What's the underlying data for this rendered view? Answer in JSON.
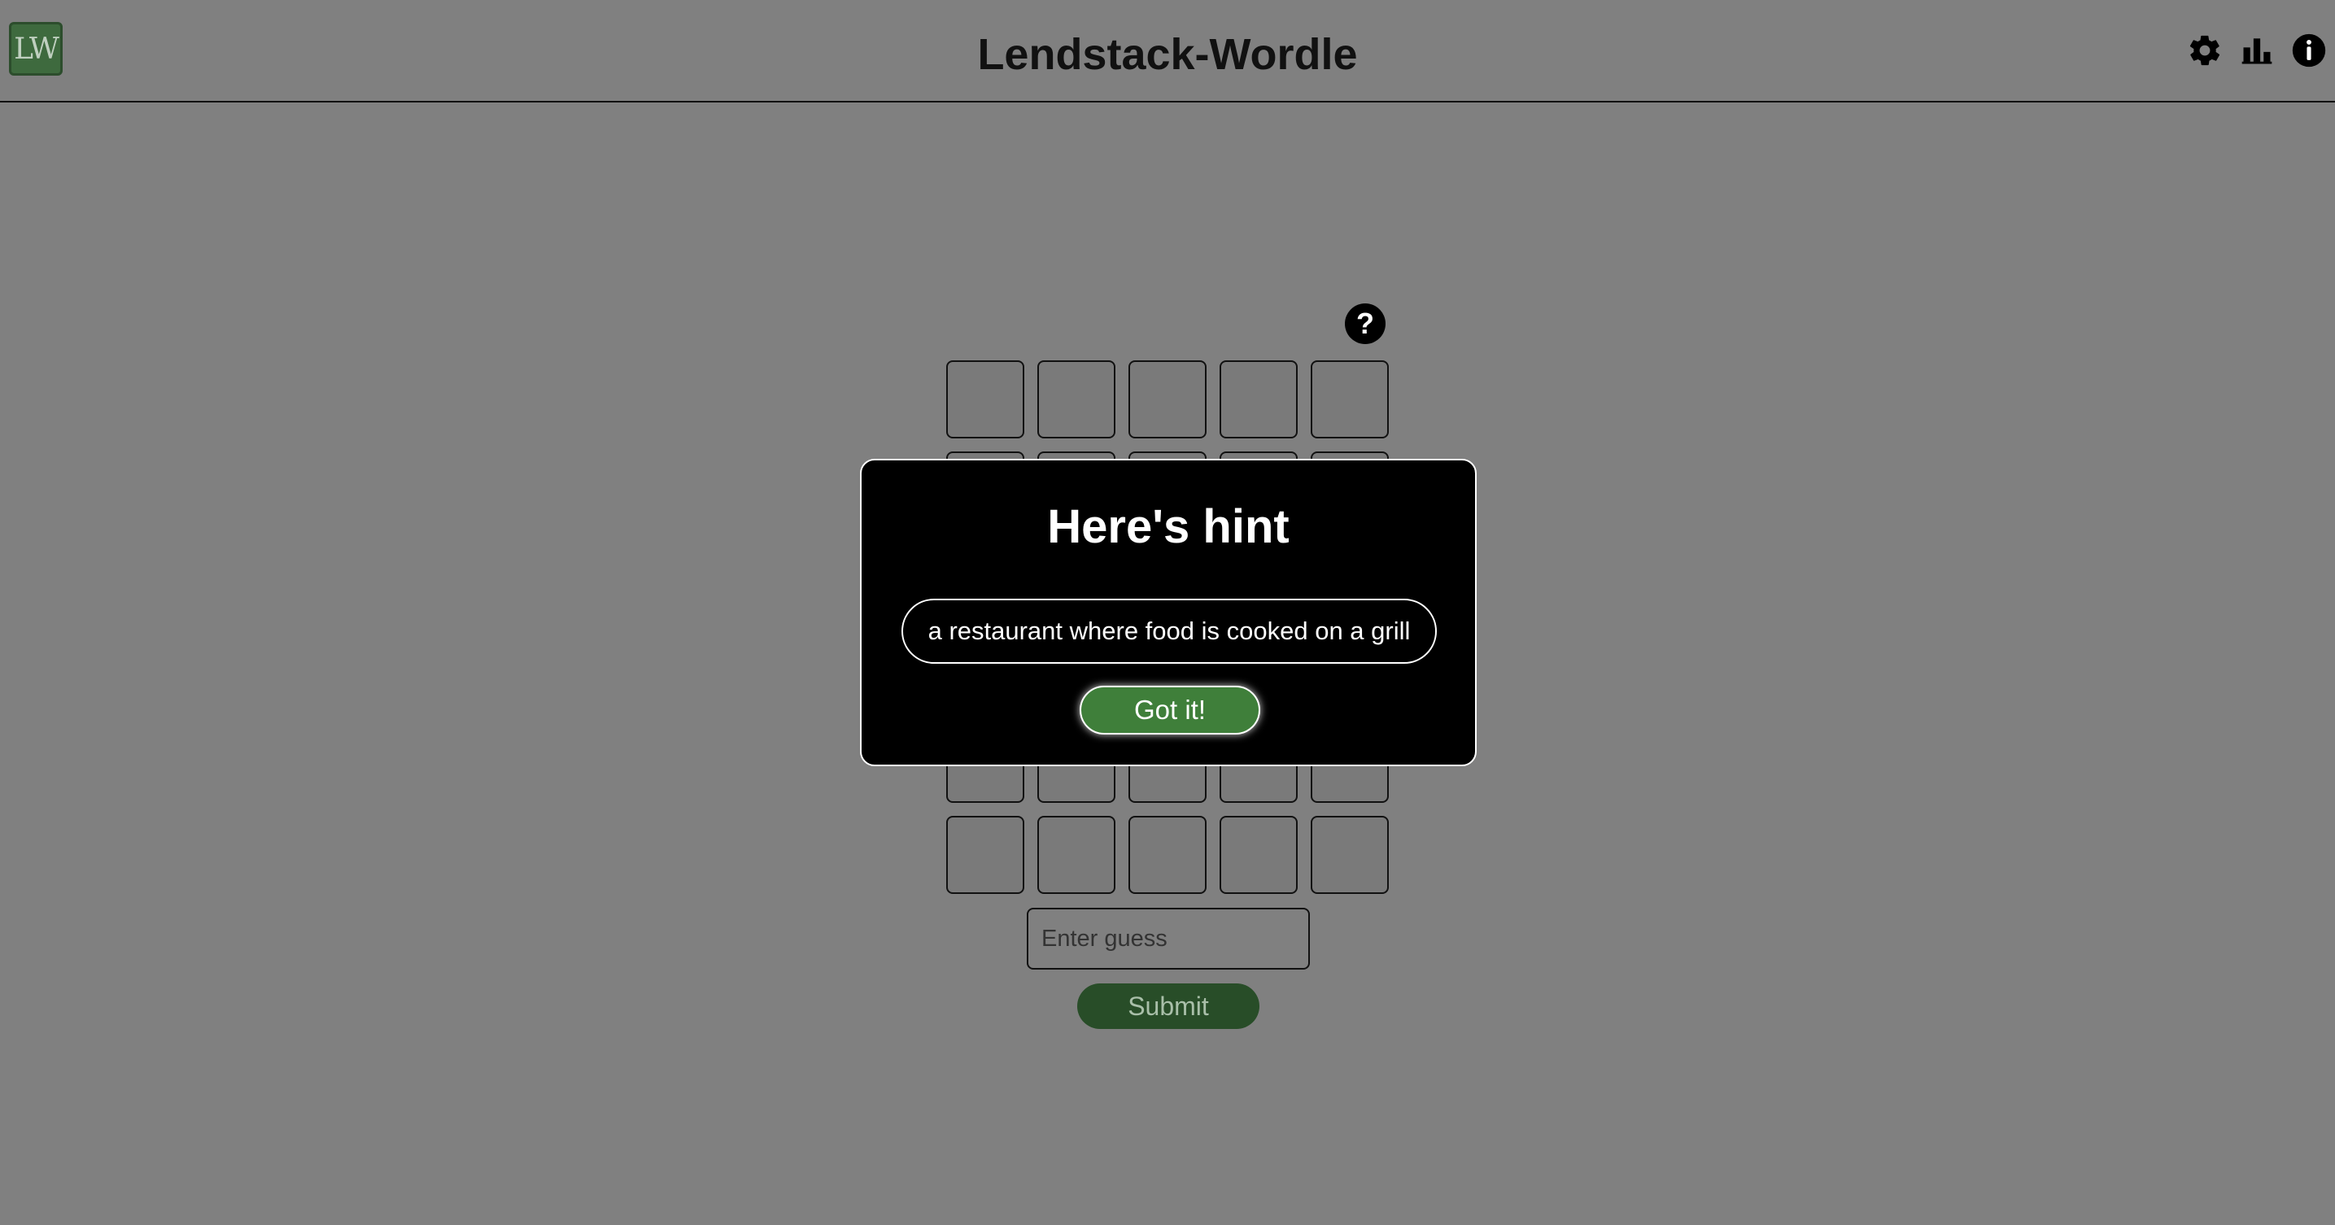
{
  "header": {
    "logo_text": "LW",
    "title": "Lendstack-Wordle",
    "icons": [
      "gear-icon",
      "bar-chart-icon",
      "info-icon"
    ]
  },
  "board": {
    "help_symbol": "?",
    "rows": 6,
    "columns": 5
  },
  "guess": {
    "placeholder": "Enter guess",
    "value": ""
  },
  "submit_label": "Submit",
  "modal": {
    "title": "Here's hint",
    "hint_text": "a restaurant where food is cooked on a grill",
    "confirm_label": "Got it!"
  },
  "colors": {
    "background": "#808080",
    "accent_green": "#3f7f3a",
    "logo_green": "#3e6a3e",
    "modal_bg": "#000000"
  }
}
